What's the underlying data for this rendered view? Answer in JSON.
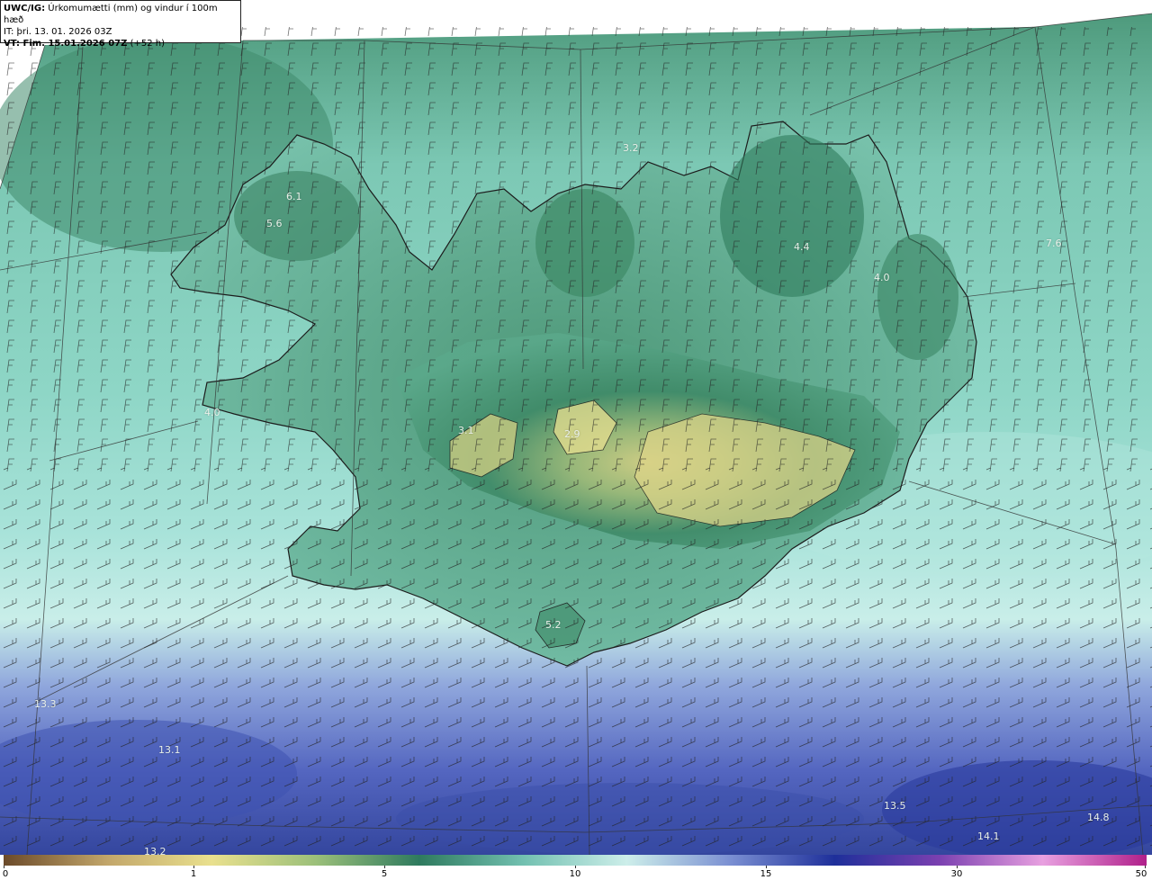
{
  "header": {
    "model": "UWC/IG:",
    "title": "Úrkomumætti (mm) og vindur í 100m hæð",
    "issue_time": "IT: þri. 13. 01. 2026 03Z",
    "valid_label": "VT: Fim. 15.01.2026 07Z",
    "lead": "(+52 h)"
  },
  "map_labels": [
    {
      "text": "6.1"
    },
    {
      "text": "5.6"
    },
    {
      "text": "4.0"
    },
    {
      "text": "3.1"
    },
    {
      "text": "2.9"
    },
    {
      "text": "4.4"
    },
    {
      "text": "4.0"
    },
    {
      "text": "7.6"
    },
    {
      "text": "5.2"
    },
    {
      "text": "13.3"
    },
    {
      "text": "13.1"
    },
    {
      "text": "13.5"
    },
    {
      "text": "14.1"
    },
    {
      "text": "14.8"
    },
    {
      "text": "13.2"
    },
    {
      "text": "3.2"
    }
  ],
  "legend": {
    "ticks": [
      "0",
      "1",
      "5",
      "10",
      "15",
      "30",
      "50"
    ],
    "colors": [
      "#6b4a2a",
      "#c2a66a",
      "#e9e08e",
      "#9cc07a",
      "#2e7a5e",
      "#72c0b0",
      "#cdeeea",
      "#7a8fd2",
      "#1e2f9a",
      "#7a40b0",
      "#e8a0e0",
      "#b0208a"
    ]
  },
  "colors": {
    "land_low": "#d8cc7c",
    "land_mid": "#3f8a68",
    "sea_teal": "#7fcfc0",
    "sea_light": "#c6ece6",
    "sea_blue": "#5a6ec8",
    "sea_deep": "#2c3c9e"
  }
}
